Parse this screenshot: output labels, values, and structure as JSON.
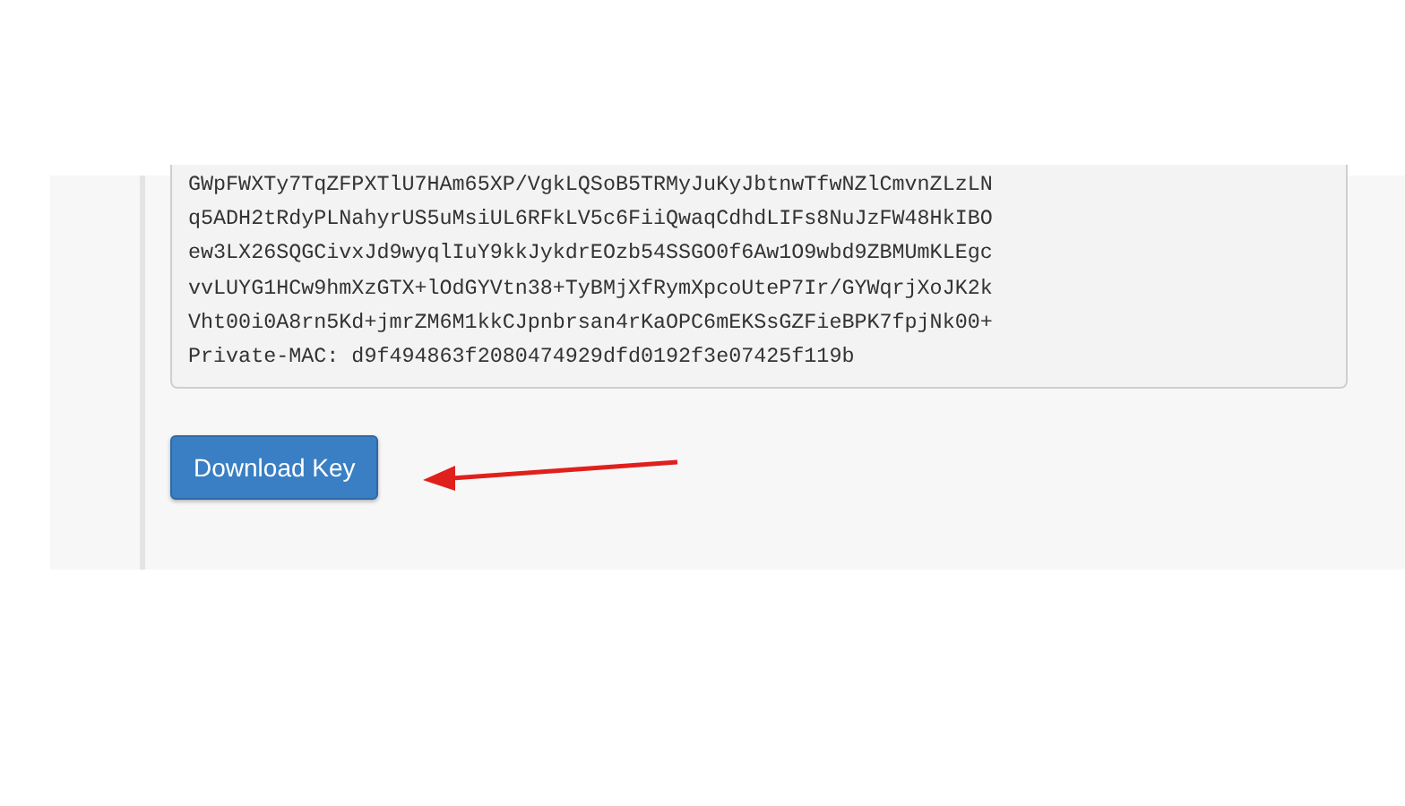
{
  "key_lines": [
    "GWpFWXTy7TqZFPXTlU7HAm65XP/VgkLQSoB5TRMyJuKyJbtnwTfwNZlCmvnZLzLN",
    "q5ADH2tRdyPLNahyrUS5uMsiUL6RFkLV5c6FiiQwaqCdhdLIFs8NuJzFW48HkIBO",
    "ew3LX26SQGCivxJd9wyqlIuY9kkJykdrEOzb54SSGO0f6Aw1O9wbd9ZBMUmKLEgc",
    "vvLUYG1HCw9hmXzGTX+lOdGYVtn38+TyBMjXfRymXpcoUteP7Ir/GYWqrjXoJK2k",
    "Vht00i0A8rn5Kd+jmrZM6M1kkCJpnbrsan4rKaOPC6mEKSsGZFieBPK7fpjNk00+",
    "Private-MAC: d9f494863f2080474929dfd0192f3e07425f119b"
  ],
  "download_button": {
    "label": "Download Key"
  }
}
